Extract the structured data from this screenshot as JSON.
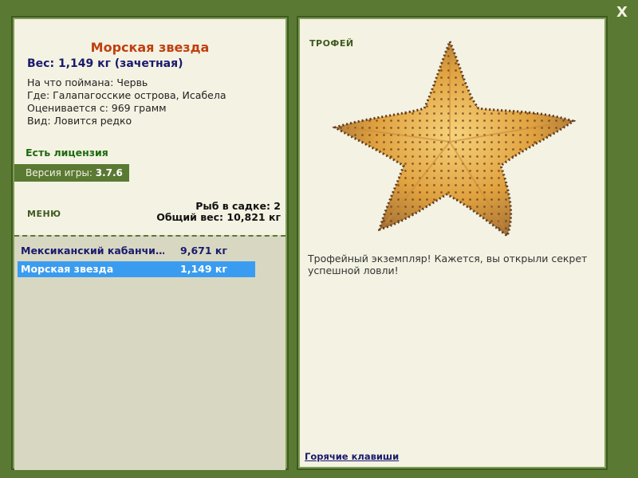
{
  "close_label": "X",
  "fish": {
    "name": "Морская звезда",
    "weight_line": "Вес: 1,149 кг (зачетная)",
    "bait_line": "На что поймана: Червь",
    "location_line": "Где: Галапагосские острова, Исабела",
    "score_line": "Оценивается с: 969 грамм",
    "rarity_line": "Вид: Ловится редко"
  },
  "license_text": "Есть лицензия",
  "version": {
    "label": "Версия игры: ",
    "value": "3.7.6"
  },
  "menu_label": "МЕНЮ",
  "keepnet": {
    "count_line": "Рыб в садке: 2",
    "total_line": "Общий вес: 10,821 кг"
  },
  "catch_list": [
    {
      "name": "Мексиканский кабанчи…",
      "weight": "9,671 кг"
    },
    {
      "name": "Морская звезда",
      "weight": "1,149 кг"
    }
  ],
  "trophy": {
    "label": "ТРОФЕЙ",
    "text": "Трофейный экземпляр! Кажется, вы открыли секрет успешной ловли!"
  },
  "hotkeys_link": "Горячие клавиши",
  "colors": {
    "frame": "#5a7a33",
    "panel": "#f4f2e2",
    "selection": "#3a9cf0",
    "title": "#c04010"
  },
  "icons": {
    "close": "close-icon",
    "trophy_image": "starfish-image"
  }
}
